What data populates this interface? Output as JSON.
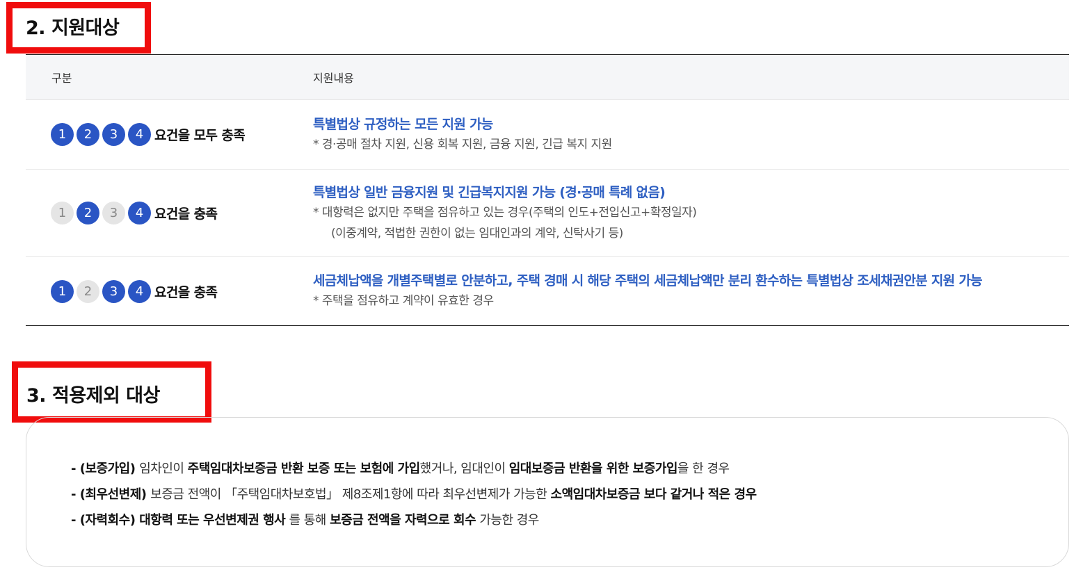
{
  "section2": {
    "title": "2. 지원대상"
  },
  "table": {
    "headers": [
      "구분",
      "지원내용"
    ],
    "rows": [
      {
        "badges": [
          {
            "label": "1",
            "active": true
          },
          {
            "label": "2",
            "active": true
          },
          {
            "label": "3",
            "active": true
          },
          {
            "label": "4",
            "active": true
          }
        ],
        "condition": "요건을 모두 충족",
        "main": "특별법상 규정하는 모든 지원 가능",
        "notes": [
          "* 경·공매 절차 지원, 신용 회복 지원, 금융 지원, 긴급 복지 지원"
        ]
      },
      {
        "badges": [
          {
            "label": "1",
            "active": false
          },
          {
            "label": "2",
            "active": true
          },
          {
            "label": "3",
            "active": false
          },
          {
            "label": "4",
            "active": true
          }
        ],
        "condition": "요건을 충족",
        "main": "특별법상 일반 금융지원 및 긴급복지지원 가능 (경·공매 특례 없음)",
        "notes": [
          "* 대항력은 없지만 주택을 점유하고 있는 경우(주택의 인도+전입신고+확정일자)",
          "(이중계약, 적법한 권한이 없는 임대인과의 계약, 신탁사기 등)"
        ]
      },
      {
        "badges": [
          {
            "label": "1",
            "active": true
          },
          {
            "label": "2",
            "active": false
          },
          {
            "label": "3",
            "active": true
          },
          {
            "label": "4",
            "active": true
          }
        ],
        "condition": "요건을 충족",
        "main": "세금체납액을 개별주택별로 안분하고, 주택 경매 시 해당 주택의 세금체납액만 분리 환수하는 특별법상 조세채권안분 지원 가능",
        "notes": [
          "* 주택을 점유하고 계약이 유효한 경우"
        ]
      }
    ]
  },
  "section3": {
    "title": "3. 적용제외 대상",
    "items": [
      [
        {
          "t": "- (보증가입) ",
          "b": true
        },
        {
          "t": "임차인이 ",
          "b": false
        },
        {
          "t": "주택임대차보증금 반환 보증 또는 보험에 가입",
          "b": true
        },
        {
          "t": "했거나, 임대인이 ",
          "b": false
        },
        {
          "t": "임대보증금 반환을 위한 보증가입",
          "b": true
        },
        {
          "t": "을 한 경우",
          "b": false
        }
      ],
      [
        {
          "t": "- (최우선변제) ",
          "b": true
        },
        {
          "t": "보증금 전액이 「주택임대차보호법」 제8조제1항에 따라 최우선변제가 가능한 ",
          "b": false
        },
        {
          "t": "소액임대차보증금 보다 같거나 적은 경우",
          "b": true
        }
      ],
      [
        {
          "t": "- (자력회수) 대항력 또는 우선변제권 행사",
          "b": true
        },
        {
          "t": " 를 통해 ",
          "b": false
        },
        {
          "t": "보증금 전액을 자력으로 회수",
          "b": true
        },
        {
          "t": " 가능한 경우",
          "b": false
        }
      ]
    ]
  },
  "colors": {
    "accent": "#2a55c4",
    "highlight_border": "#f00d0d",
    "badge_inactive": "#e5e5e5"
  }
}
